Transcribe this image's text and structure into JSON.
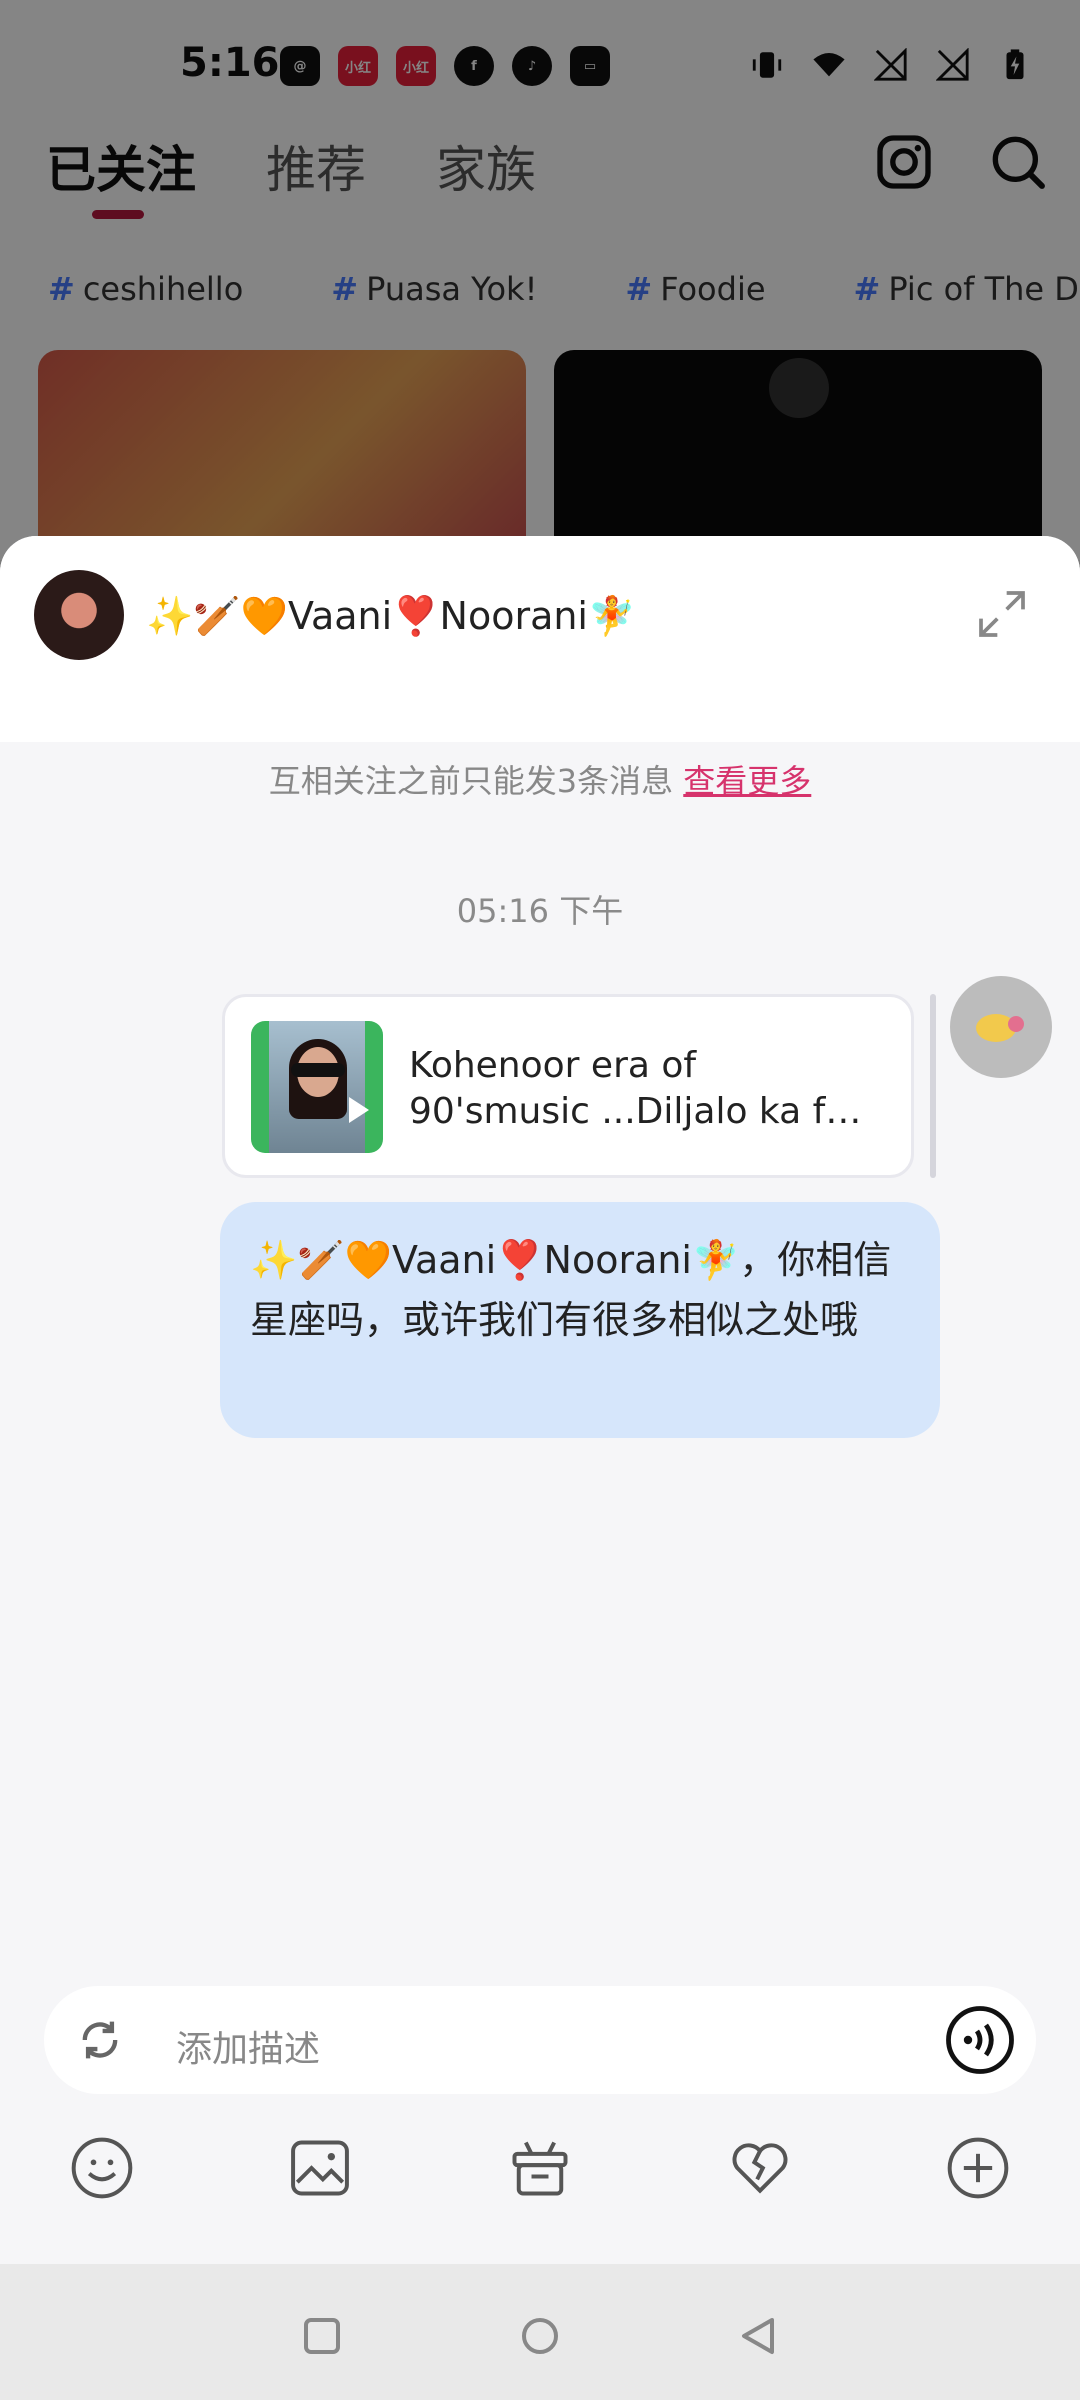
{
  "status_bar": {
    "time": "5:16",
    "app_icons": [
      "threads-icon",
      "xiaohongshu-icon",
      "xiaohongshu-icon",
      "facebook-icon",
      "tiktok-icon",
      "inbox-icon"
    ],
    "system_icons": [
      "vibrate-icon",
      "wifi-icon",
      "no-signal-icon",
      "no-signal-icon",
      "battery-charging-icon"
    ]
  },
  "top_tabs": [
    {
      "label": "已关注",
      "active": true
    },
    {
      "label": "推荐",
      "active": false
    },
    {
      "label": "家族",
      "active": false
    }
  ],
  "hashtags": [
    "ceshihello",
    "Puasa Yok!",
    "Foodie",
    "Pic of The D"
  ],
  "chat": {
    "contact_name": "✨🏏🧡Vaani❣️Noorani🧚",
    "notice_text": "互相关注之前只能发3条消息",
    "notice_link": "查看更多",
    "timestamp": "05:16 下午",
    "shared_card": {
      "title_line1": "Kohenoor era of",
      "title_line2": "90'smusic ...Diljalo ka fav..."
    },
    "message_text": "✨🏏🧡Vaani❣️Noorani🧚，你相信星座吗，或许我们有很多相似之处哦"
  },
  "input": {
    "placeholder": "添加描述"
  },
  "toolbar_icons": [
    "emoji-icon",
    "image-icon",
    "gift-icon",
    "heart-break-icon",
    "plus-icon"
  ],
  "colors": {
    "accent": "#b5173f",
    "link": "#d6336c",
    "bubble": "#d6e6fb"
  }
}
